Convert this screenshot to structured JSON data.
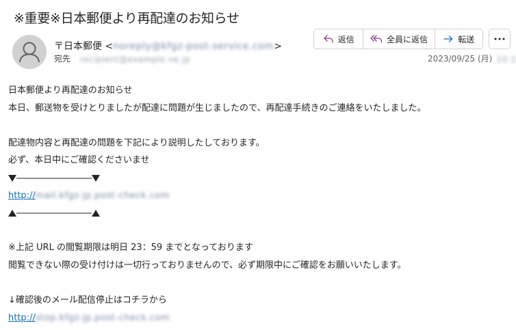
{
  "email": {
    "subject": "※重要※日本郵便より再配達のお知らせ",
    "sender_name": "〒日本郵便",
    "sender_address": "noreply@kfgz-post-service.com",
    "to_label": "宛先",
    "to_address": "recipient@example.ne.jp",
    "date": "2023/09/25 (月)",
    "date_time": "10:15"
  },
  "toolbar": {
    "reply_label": "返信",
    "reply_all_label": "全員に返信",
    "forward_label": "転送",
    "more_label": "…"
  },
  "body": {
    "line1": "日本郵便より再配達のお知らせ",
    "line2": "本日、郵送物を受けとりましたが配達に問題が生じましたので、再配達手続きのご連絡をいたしました。",
    "line3": "配達物内容と再配達の問題を下記により説明したしております。",
    "line4": "必ず、本日中にご確認くださいませ",
    "link1_prefix": "http://",
    "link1_rest": "mail.kfgz-jp.post-check.com",
    "line5": "※上記 URL の閲覧期限は明日 23：59 までとなっております",
    "line6": "閲覧できない際の受け付けは一切行っておりませんので、必ず期限中にご確認をお願いいたします。",
    "line7": "↓確認後のメール配信停止はコチラから",
    "link2_prefix": "http://",
    "link2_rest": "stop.kfgz-jp.post-check.com"
  },
  "colors": {
    "accent": "#0f6cbd",
    "reply_icon": "#8a3a8f",
    "forward_icon": "#0f6cbd",
    "avatar_bg": "#d1d1d1"
  }
}
